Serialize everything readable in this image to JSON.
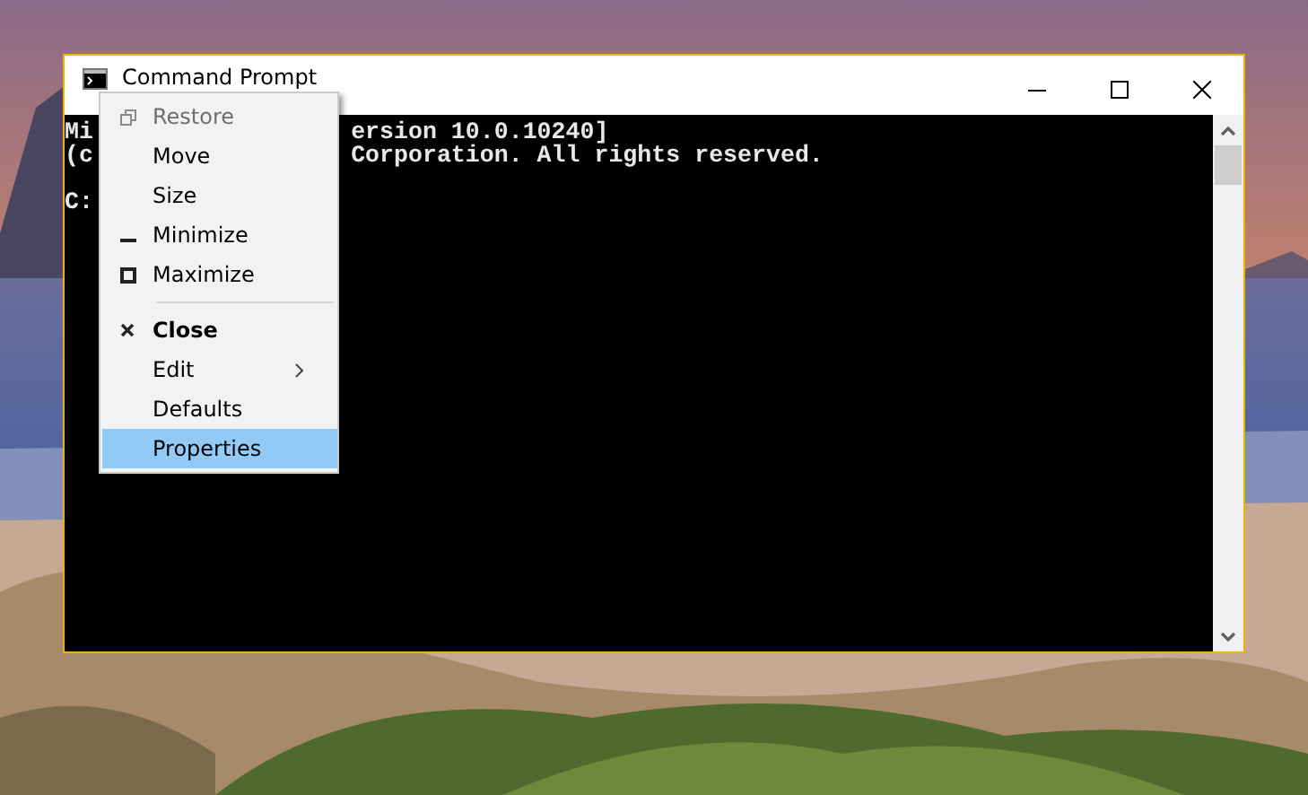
{
  "window": {
    "title": "Command Prompt",
    "focused": true
  },
  "console": {
    "lines": [
      {
        "left": "Mi",
        "right": "ersion 10.0.10240]"
      },
      {
        "left": "(c",
        "right": "Corporation. All rights reserved."
      },
      {
        "left": "C:"
      }
    ]
  },
  "system_menu": {
    "items": [
      {
        "kind": "item",
        "label": "Restore",
        "disabled": true,
        "selected": false
      },
      {
        "kind": "item",
        "label": "Move",
        "disabled": false,
        "selected": false
      },
      {
        "kind": "item",
        "label": "Size",
        "disabled": false,
        "selected": false
      },
      {
        "kind": "item",
        "label": "Minimize",
        "disabled": false,
        "selected": false
      },
      {
        "kind": "item",
        "label": "Maximize",
        "disabled": false,
        "selected": false
      },
      {
        "kind": "separator"
      },
      {
        "kind": "item",
        "label": "Close",
        "default": true,
        "disabled": false,
        "selected": false
      },
      {
        "kind": "item",
        "label": "Edit",
        "submenu": true,
        "disabled": false,
        "selected": false
      },
      {
        "kind": "item",
        "label": "Defaults",
        "disabled": false,
        "selected": false
      },
      {
        "kind": "item",
        "label": "Properties",
        "disabled": false,
        "selected": true
      }
    ]
  }
}
